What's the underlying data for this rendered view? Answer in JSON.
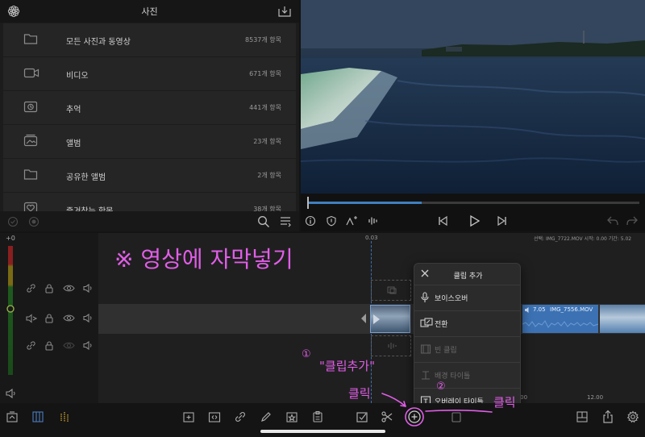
{
  "library": {
    "title": "사진",
    "items": [
      {
        "label": "모든 사진과 동영상",
        "count": "8537개 항목",
        "icon": "folder-icon"
      },
      {
        "label": "비디오",
        "count": "671개 항목",
        "icon": "video-camera-icon"
      },
      {
        "label": "추억",
        "count": "441개 항목",
        "icon": "memories-icon"
      },
      {
        "label": "앨범",
        "count": "23개 항목",
        "icon": "album-icon"
      },
      {
        "label": "공유한 앨범",
        "count": "2개 항목",
        "icon": "folder-icon"
      },
      {
        "label": "즐겨찾는 항목",
        "count": "38개 항목",
        "icon": "heart-icon"
      }
    ]
  },
  "timeline": {
    "level_label": "+0",
    "ruler_start": "0.03",
    "ruler_marks": [
      "10.00",
      "12.00"
    ],
    "selection_info": "선택: IMG_7722.MOV 시작: 0.00 기간: 5.02",
    "clip_2_label": "7.05 IMG_7556.MOV",
    "clip_2_time": "7.05",
    "clip_2_name": "IMG_7556.MOV"
  },
  "popup": {
    "title": "클립 추가",
    "items": [
      {
        "label": "보이스오버",
        "enabled": true
      },
      {
        "label": "전환",
        "enabled": true
      },
      {
        "label": "빈 클립",
        "enabled": false
      },
      {
        "label": "배경 타이틀",
        "enabled": false
      },
      {
        "label": "오버레이 타이틀",
        "enabled": true
      }
    ]
  },
  "annotations": {
    "headline": "※ 영상에 자막넣기",
    "step1_num": "①",
    "step1_text": "\"클립추가\"",
    "step1_click": "클릭",
    "step2_num": "②",
    "step2_click": "클릭"
  },
  "colors": {
    "accent": "#3f7fc0",
    "annotation": "#e15ee8",
    "clip": "#3c72b4"
  }
}
